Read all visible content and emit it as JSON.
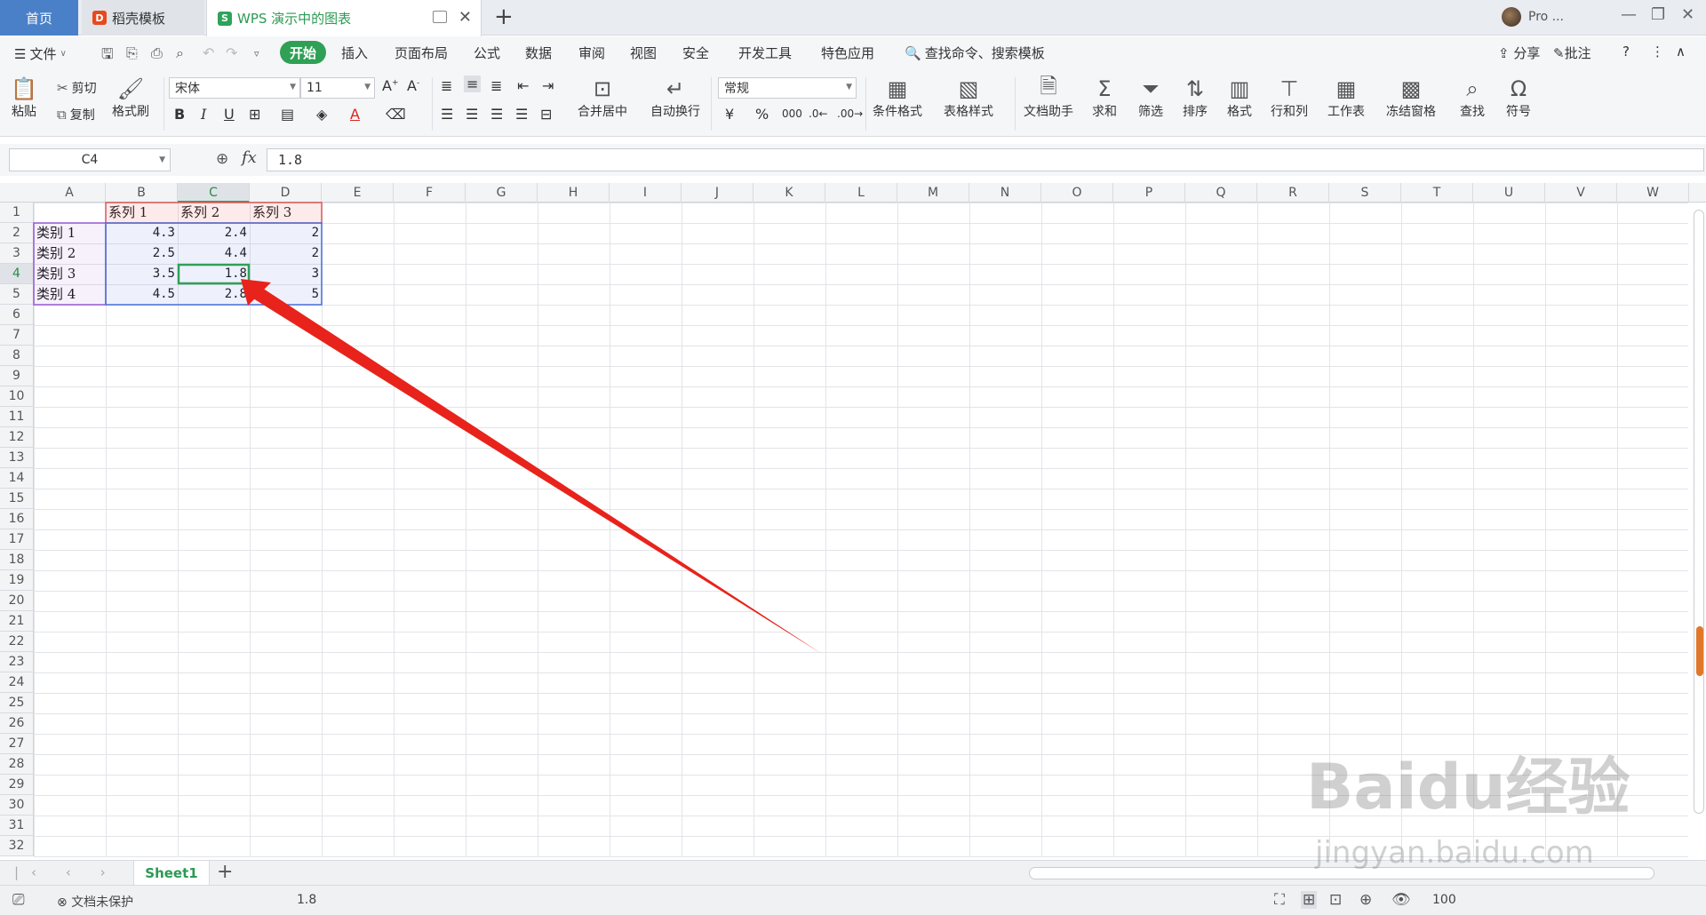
{
  "tabs": {
    "home": "首页",
    "docer": "稻壳模板",
    "doc": "WPS 演示中的图表",
    "add": "+"
  },
  "user": {
    "name": "Pro ..."
  },
  "menubar": {
    "file": "文件",
    "items": [
      "开始",
      "插入",
      "页面布局",
      "公式",
      "数据",
      "审阅",
      "视图",
      "安全",
      "开发工具",
      "特色应用"
    ],
    "search": "查找命令、搜索模板",
    "share": "分享",
    "comment": "批注"
  },
  "ribbon": {
    "paste": "粘贴",
    "cut": "剪切",
    "copy": "复制",
    "format_painter": "格式刷",
    "font_name": "宋体",
    "font_size": "11",
    "merge_center": "合并居中",
    "wrap": "自动换行",
    "number_format": "常规",
    "cond_format": "条件格式",
    "table_style": "表格样式",
    "doc_assist": "文档助手",
    "sum": "求和",
    "filter": "筛选",
    "sort": "排序",
    "format": "格式",
    "rowcol": "行和列",
    "worksheet": "工作表",
    "freeze": "冻结窗格",
    "find": "查找",
    "symbol": "符号"
  },
  "formula": {
    "cell_ref": "C4",
    "fx": "fx",
    "value": "1.8"
  },
  "grid": {
    "columns": [
      "A",
      "B",
      "C",
      "D",
      "E",
      "F",
      "G",
      "H",
      "I",
      "J",
      "K",
      "L",
      "M",
      "N",
      "O",
      "P",
      "Q",
      "R",
      "S",
      "T",
      "U",
      "V",
      "W"
    ],
    "rows": [
      "1",
      "2",
      "3",
      "4",
      "5",
      "6",
      "7",
      "8",
      "9",
      "10",
      "11",
      "12",
      "13",
      "14",
      "15",
      "16",
      "17",
      "18",
      "19",
      "20",
      "21",
      "22",
      "23",
      "24",
      "25",
      "26",
      "27",
      "28",
      "29",
      "30",
      "31",
      "32"
    ],
    "selected_col": "C",
    "selected_row": "4",
    "header_row": [
      "",
      "系列 1",
      "系列 2",
      "系列 3"
    ],
    "data_rows": [
      [
        "类别 1",
        "4.3",
        "2.4",
        "2"
      ],
      [
        "类别 2",
        "2.5",
        "4.4",
        "2"
      ],
      [
        "类别 3",
        "3.5",
        "1.8",
        "3"
      ],
      [
        "类别 4",
        "4.5",
        "2.8",
        "5"
      ]
    ]
  },
  "sheets": {
    "active": "Sheet1"
  },
  "status": {
    "protect": "文档未保护",
    "value": "1.8",
    "zoom": "100"
  },
  "watermark": {
    "brand": "Baidu经验",
    "url": "jingyan.baidu.com"
  },
  "colors": {
    "accent": "#2fa055",
    "arrow": "#e8231b"
  }
}
